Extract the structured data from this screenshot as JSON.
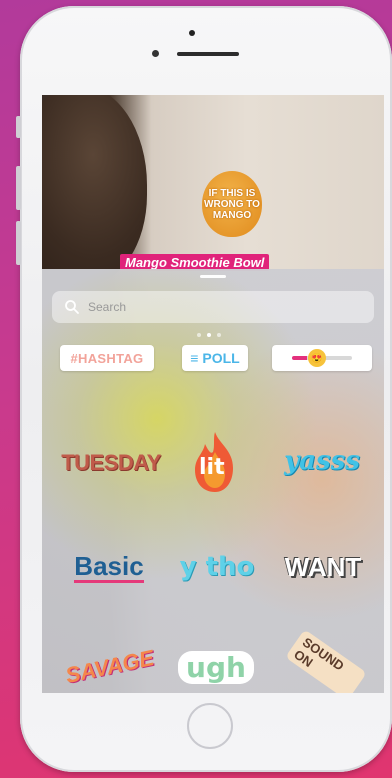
{
  "story": {
    "mango_sticker_text": "IF THIS IS WRONG TO MANGO",
    "caption": "Mango Smoothie Bowl"
  },
  "tray": {
    "search": {
      "placeholder": "Search",
      "value": ""
    },
    "page_dots": {
      "count": 3,
      "active_index": 1
    },
    "stickers_row1": {
      "hashtag": "#HASHTAG",
      "poll": "≡ POLL",
      "slider_emoji": "😍"
    },
    "stickers": {
      "tuesday": "TUESDAY",
      "lit": "lit",
      "yass": "yasss",
      "basic": "Basic",
      "ytho": "y tho",
      "want": "WANT",
      "savage": "SAVAGE",
      "ugh": "ugh",
      "sound_on": "SOUND ON"
    }
  },
  "colors": {
    "accent_pink": "#e0237a",
    "poll_blue": "#4bb6e8",
    "background_gradient_top": "#b23a9b",
    "background_gradient_bottom": "#e0356f"
  },
  "icons": [
    "search-icon",
    "flame-icon"
  ]
}
